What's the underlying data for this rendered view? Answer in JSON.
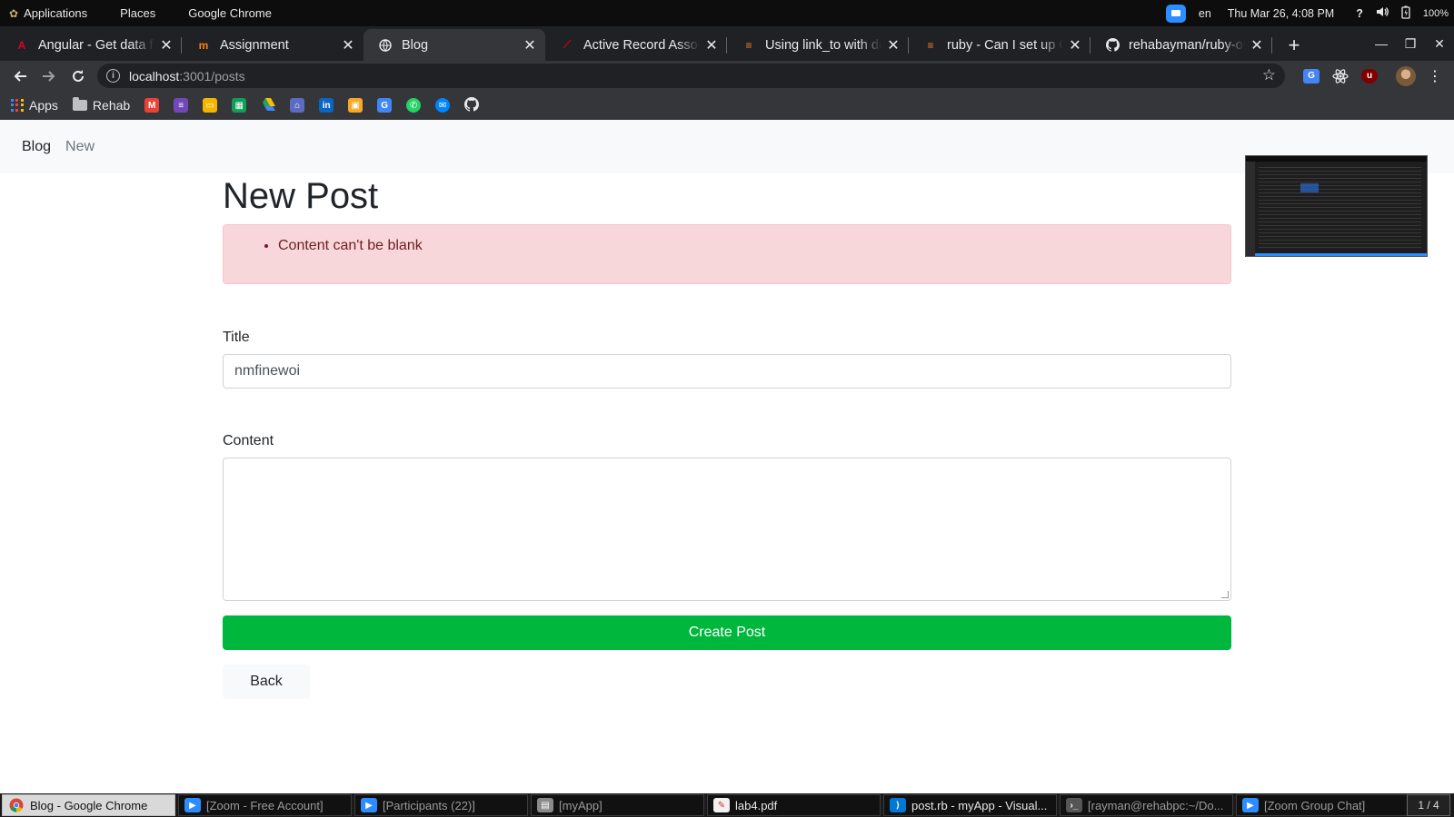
{
  "system_bar": {
    "applications": "Applications",
    "places": "Places",
    "active_app": "Google Chrome",
    "language": "en",
    "datetime": "Thu Mar 26,  4:08 PM",
    "help": "?",
    "battery": "100%"
  },
  "tabs": [
    {
      "title": "Angular - Get data from",
      "favicon": "angular-icon",
      "color": "#dd0031"
    },
    {
      "title": "Assignment",
      "favicon": "moodle-icon",
      "color": "#f98012"
    },
    {
      "title": "Blog",
      "favicon": "globe-icon",
      "color": "#e8eaed",
      "active": true
    },
    {
      "title": "Active Record Associations",
      "favicon": "rails-icon",
      "color": "#cc0000"
    },
    {
      "title": "Using link_to with delete",
      "favicon": "stackoverflow-icon",
      "color": "#f48024"
    },
    {
      "title": "ruby - Can I set up Cascade",
      "favicon": "stackoverflow-icon",
      "color": "#f48024"
    },
    {
      "title": "rehabayman/ruby-on-rails",
      "favicon": "github-icon",
      "color": "#e8eaed"
    }
  ],
  "toolbar": {
    "url_host": "localhost",
    "url_path": ":3001/posts"
  },
  "bookmarks": {
    "apps": "Apps",
    "folder": "Rehab",
    "icons": [
      {
        "name": "gmail-icon",
        "color": "#ea4335",
        "glyph": "M"
      },
      {
        "name": "google-forms-icon",
        "color": "#7248b9",
        "glyph": "≡"
      },
      {
        "name": "google-slides-icon",
        "color": "#f4b400",
        "glyph": "▭"
      },
      {
        "name": "google-sheets-icon",
        "color": "#0f9d58",
        "glyph": "▦"
      },
      {
        "name": "google-drive-icon",
        "color": "#1fa463",
        "glyph": "▲"
      },
      {
        "name": "graduation-cap-icon",
        "color": "#5c6bc0",
        "glyph": "⌂"
      },
      {
        "name": "linkedin-icon",
        "color": "#0a66c2",
        "glyph": "in"
      },
      {
        "name": "bookmark-app-icon",
        "color": "#f9a825",
        "glyph": "▣"
      },
      {
        "name": "google-translate-icon",
        "color": "#4285f4",
        "glyph": "G"
      },
      {
        "name": "whatsapp-icon",
        "color": "#25d366",
        "glyph": "✆"
      },
      {
        "name": "messenger-icon",
        "color": "#0084ff",
        "glyph": "✉"
      },
      {
        "name": "github-icon",
        "color": "#24292e",
        "glyph": "●"
      }
    ]
  },
  "site_nav": {
    "brand": "Blog",
    "new_link": "New"
  },
  "form": {
    "heading": "New Post",
    "errors": [
      "Content can't be blank"
    ],
    "title_label": "Title",
    "title_value": "nmfinewoi",
    "content_label": "Content",
    "content_value": "",
    "submit_label": "Create Post",
    "back_label": "Back"
  },
  "taskbar": [
    {
      "label": "Blog - Google Chrome",
      "icon": "chrome-icon",
      "color": "#4285f4",
      "active": true
    },
    {
      "label": "[Zoom - Free Account]",
      "icon": "zoom-icon",
      "color": "#2d8cff"
    },
    {
      "label": "[Participants (22)]",
      "icon": "zoom-icon",
      "color": "#2d8cff"
    },
    {
      "label": "[myApp]",
      "icon": "file-manager-icon",
      "color": "#8a8a8a"
    },
    {
      "label": "lab4.pdf",
      "icon": "pdf-icon",
      "color": "#d93025",
      "bright": true
    },
    {
      "label": "post.rb - myApp - Visual...",
      "icon": "vscode-icon",
      "color": "#0078d4",
      "bright": true
    },
    {
      "label": "[rayman@rehabpc:~/Do...",
      "icon": "terminal-icon",
      "color": "#555555"
    },
    {
      "label": "[Zoom Group Chat]",
      "icon": "zoom-icon",
      "color": "#2d8cff"
    }
  ],
  "workspace": "1 / 4"
}
